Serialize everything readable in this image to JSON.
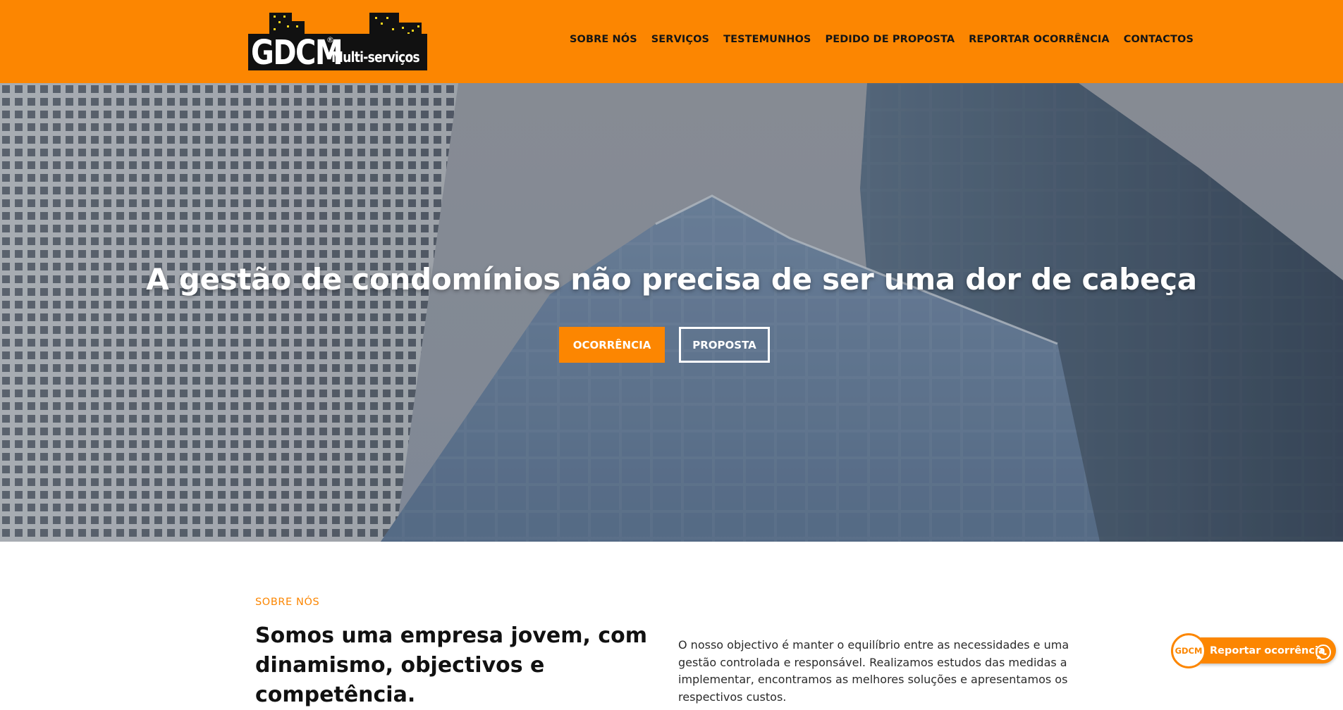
{
  "brand": {
    "logo_main": "GDCM",
    "logo_registered": "®",
    "logo_sub": "Multi-serviços"
  },
  "nav": {
    "items": [
      "SOBRE NÓS",
      "SERVIÇOS",
      "TESTEMUNHOS",
      "PEDIDO DE PROPOSTA",
      "REPORTAR OCORRÊNCIA",
      "CONTACTOS"
    ]
  },
  "hero": {
    "title": "A gestão de condomínios não precisa de ser uma dor de cabeça",
    "primary_button": "OCORRÊNCIA",
    "secondary_button": "PROPOSTA"
  },
  "about": {
    "tag": "SOBRE NÓS",
    "heading": "Somos uma empresa jovem, com dinamismo, objectivos e competência.",
    "body": "O nosso objectivo é manter o equilíbrio entre as necessidades e uma gestão controlada e responsável. Realizamos estudos das medidas a implementar, encontramos as melhores soluções e apresentamos os respectivos custos."
  },
  "floating": {
    "avatar_text": "GDCM",
    "label": "Reportar ocorrência",
    "icon": "whatsapp-icon"
  },
  "colors": {
    "accent": "#fc8601",
    "header_text": "#151515"
  }
}
